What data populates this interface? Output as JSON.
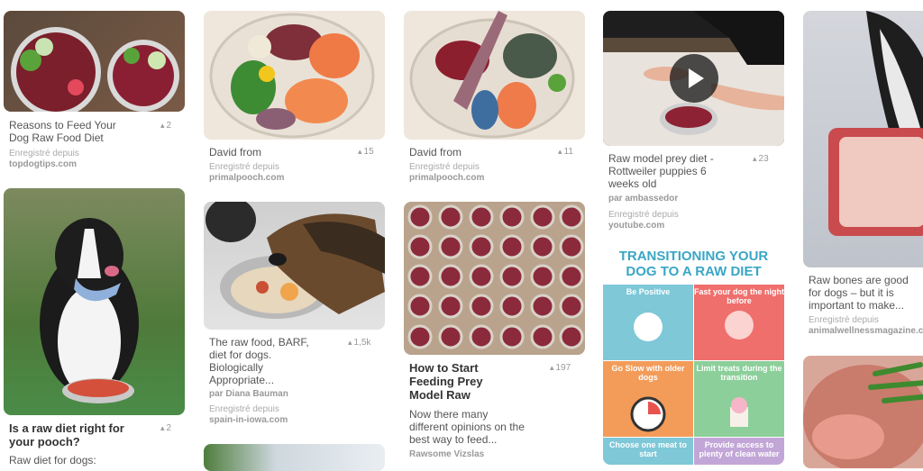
{
  "pins": [
    {
      "title": "Reasons to Feed Your Dog Raw Food Diet",
      "count": "2",
      "saved": "Enregistré depuis",
      "source": "topdogtips.com"
    },
    {
      "title": "Is a raw diet right for your pooch?",
      "count": "2",
      "description": "Raw diet for dogs:"
    },
    {
      "title": "David from",
      "count": "15",
      "saved": "Enregistré depuis",
      "source": "primalpooch.com"
    },
    {
      "title": "The raw food, BARF, diet for dogs. Biologically Appropriate...",
      "count": "1,5k",
      "by": "par Diana Bauman",
      "saved": "Enregistré depuis",
      "source": "spain-in-iowa.com"
    },
    {
      "title": "David from",
      "count": "11",
      "saved": "Enregistré depuis",
      "source": "primalpooch.com"
    },
    {
      "title": "How to Start Feeding Prey Model Raw",
      "count": "197",
      "description": "Now there many different opinions on the best way to feed...",
      "source": "Rawsome Vizslas"
    },
    {
      "title": "Raw model prey diet - Rottweiler puppies 6 weeks old",
      "count": "23",
      "by": "par ambassedor",
      "saved": "Enregistré depuis",
      "source": "youtube.com"
    },
    {
      "title": "Raw bones are good for dogs – but it is important to make...",
      "saved": "Enregistré depuis",
      "source": "animalwellnessmagazine.com"
    }
  ],
  "infographic": {
    "heading": "TRANSITIONING YOUR DOG TO A RAW DIET",
    "cells": [
      {
        "title": "Be Positive",
        "color": "#7ec8d8"
      },
      {
        "title": "Fast your dog the night before",
        "color": "#ef6f6c"
      },
      {
        "title": "Go Slow with older dogs",
        "color": "#f39c5a"
      },
      {
        "title": "Limit treats during the transition",
        "color": "#8ccf9a"
      },
      {
        "title": "Choose one meat to start",
        "color": "#7ec8d8"
      },
      {
        "title": "Provide access to plenty of clean water",
        "color": "#c3a6d8"
      }
    ]
  },
  "icons": {
    "play": "play-icon",
    "pin": "pin-icon"
  }
}
